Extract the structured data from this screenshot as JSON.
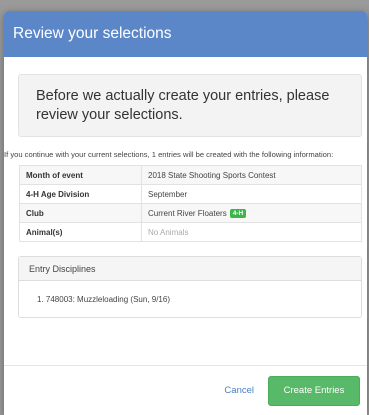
{
  "modal": {
    "title": "Review your selections",
    "notice": "Before we actually create your entries, please review your selections.",
    "info": "If you continue with your current selections, 1 entries will be created with the following information:",
    "details": [
      {
        "label": "Month of event",
        "value": "2018 State Shooting Sports Contest"
      },
      {
        "label": "4-H Age Division",
        "value": "September"
      },
      {
        "label": "Club",
        "value": "Current River Floaters",
        "badge": "4-H"
      },
      {
        "label": "Animal(s)",
        "value": "No Animals"
      }
    ],
    "disciplines": {
      "heading": "Entry Disciplines",
      "items": [
        "1. 748003: Muzzleloading (Sun, 9/16)"
      ]
    },
    "footer": {
      "cancel_label": "Cancel",
      "create_label": "Create Entries"
    }
  },
  "colors": {
    "header": "#5b87c9",
    "badge": "#3cb64a",
    "primary_button": "#58b968",
    "link": "#4a7fc3"
  }
}
